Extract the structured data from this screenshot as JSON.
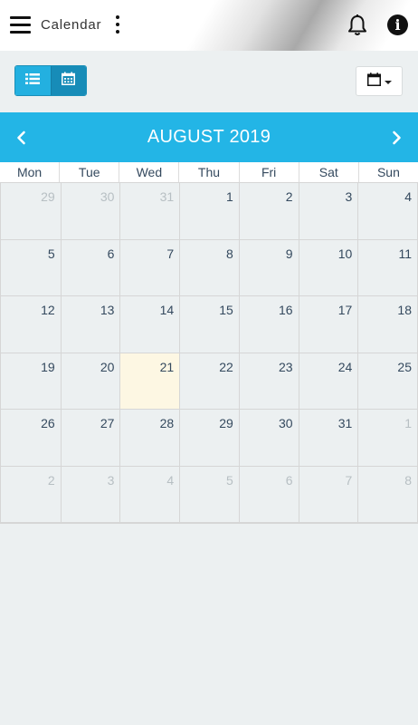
{
  "app": {
    "title": "Calendar"
  },
  "icons": {
    "menu": "hamburger-menu-icon",
    "more": "kebab-more-icon",
    "notifications": "bell-icon",
    "info": "info-icon",
    "list_view": "list-icon",
    "calendar_view": "calendar-grid-icon",
    "date_picker": "calendar-icon",
    "prev": "chevron-left-icon",
    "next": "chevron-right-icon"
  },
  "info_glyph": "i",
  "colors": {
    "accent": "#23b5e6",
    "today_bg": "#fdf7e3",
    "muted_day": "#b7bfc3"
  },
  "calendar": {
    "month_title": "AUGUST 2019",
    "weekdays": [
      "Mon",
      "Tue",
      "Wed",
      "Thu",
      "Fri",
      "Sat",
      "Sun"
    ],
    "weeks": [
      [
        {
          "n": "29",
          "other": true
        },
        {
          "n": "30",
          "other": true
        },
        {
          "n": "31",
          "other": true
        },
        {
          "n": "1"
        },
        {
          "n": "2"
        },
        {
          "n": "3"
        },
        {
          "n": "4"
        }
      ],
      [
        {
          "n": "5"
        },
        {
          "n": "6"
        },
        {
          "n": "7"
        },
        {
          "n": "8"
        },
        {
          "n": "9"
        },
        {
          "n": "10"
        },
        {
          "n": "11"
        }
      ],
      [
        {
          "n": "12"
        },
        {
          "n": "13"
        },
        {
          "n": "14"
        },
        {
          "n": "15"
        },
        {
          "n": "16"
        },
        {
          "n": "17"
        },
        {
          "n": "18"
        }
      ],
      [
        {
          "n": "19"
        },
        {
          "n": "20"
        },
        {
          "n": "21",
          "today": true
        },
        {
          "n": "22"
        },
        {
          "n": "23"
        },
        {
          "n": "24"
        },
        {
          "n": "25"
        }
      ],
      [
        {
          "n": "26"
        },
        {
          "n": "27"
        },
        {
          "n": "28"
        },
        {
          "n": "29"
        },
        {
          "n": "30"
        },
        {
          "n": "31"
        },
        {
          "n": "1",
          "other": true
        }
      ],
      [
        {
          "n": "2",
          "other": true
        },
        {
          "n": "3",
          "other": true
        },
        {
          "n": "4",
          "other": true
        },
        {
          "n": "5",
          "other": true
        },
        {
          "n": "6",
          "other": true
        },
        {
          "n": "7",
          "other": true
        },
        {
          "n": "8",
          "other": true
        }
      ]
    ]
  }
}
